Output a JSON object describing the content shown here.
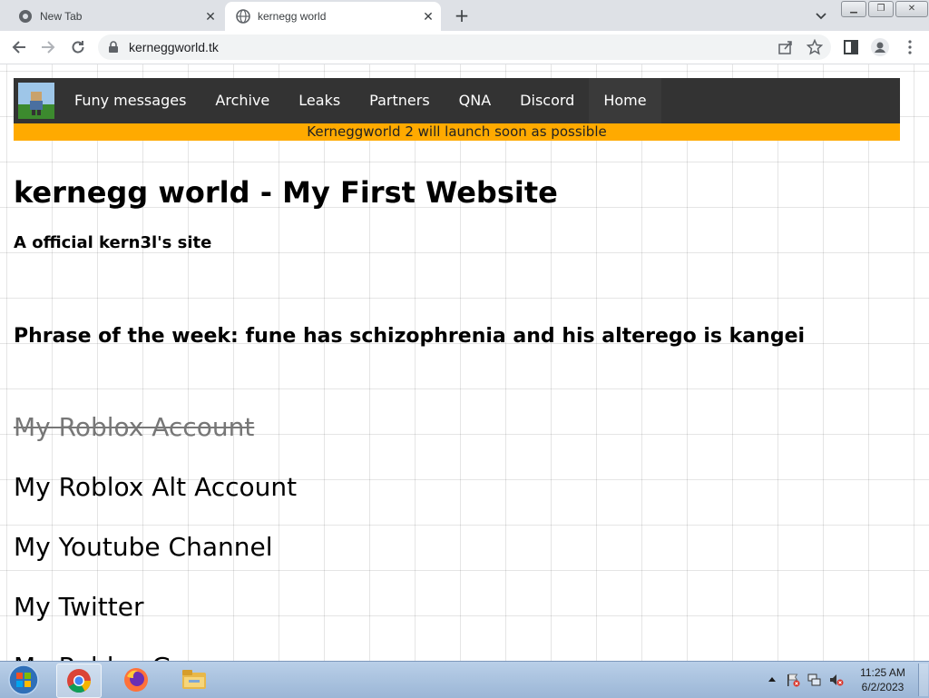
{
  "browser": {
    "tabs": [
      {
        "title": "New Tab",
        "active": false
      },
      {
        "title": "kernegg world",
        "active": true
      }
    ],
    "url": "kerneggworld.tk"
  },
  "site": {
    "nav": [
      "Funy messages",
      "Archive",
      "Leaks",
      "Partners",
      "QNA",
      "Discord",
      "Home"
    ],
    "banner": "Kerneggworld 2 will launch soon as possible",
    "title": "kernegg world - My First Website",
    "subtitle": "A official kern3l's site",
    "phrase": "Phrase of the week: fune has schizophrenia and his alterego is kangei",
    "links": [
      {
        "label": "My Roblox Account",
        "struck": true
      },
      {
        "label": "My Roblox Alt Account",
        "struck": false
      },
      {
        "label": "My Youtube Channel",
        "struck": false
      },
      {
        "label": "My Twitter",
        "struck": false
      },
      {
        "label": "My Roblox G",
        "struck": false
      }
    ],
    "colors": {
      "nav_bg": "#333333",
      "banner_bg": "#ffaa00"
    }
  },
  "taskbar": {
    "time": "11:25 AM",
    "date": "6/2/2023",
    "apps": [
      "chrome-icon",
      "firefox-icon",
      "file-explorer-icon"
    ]
  }
}
